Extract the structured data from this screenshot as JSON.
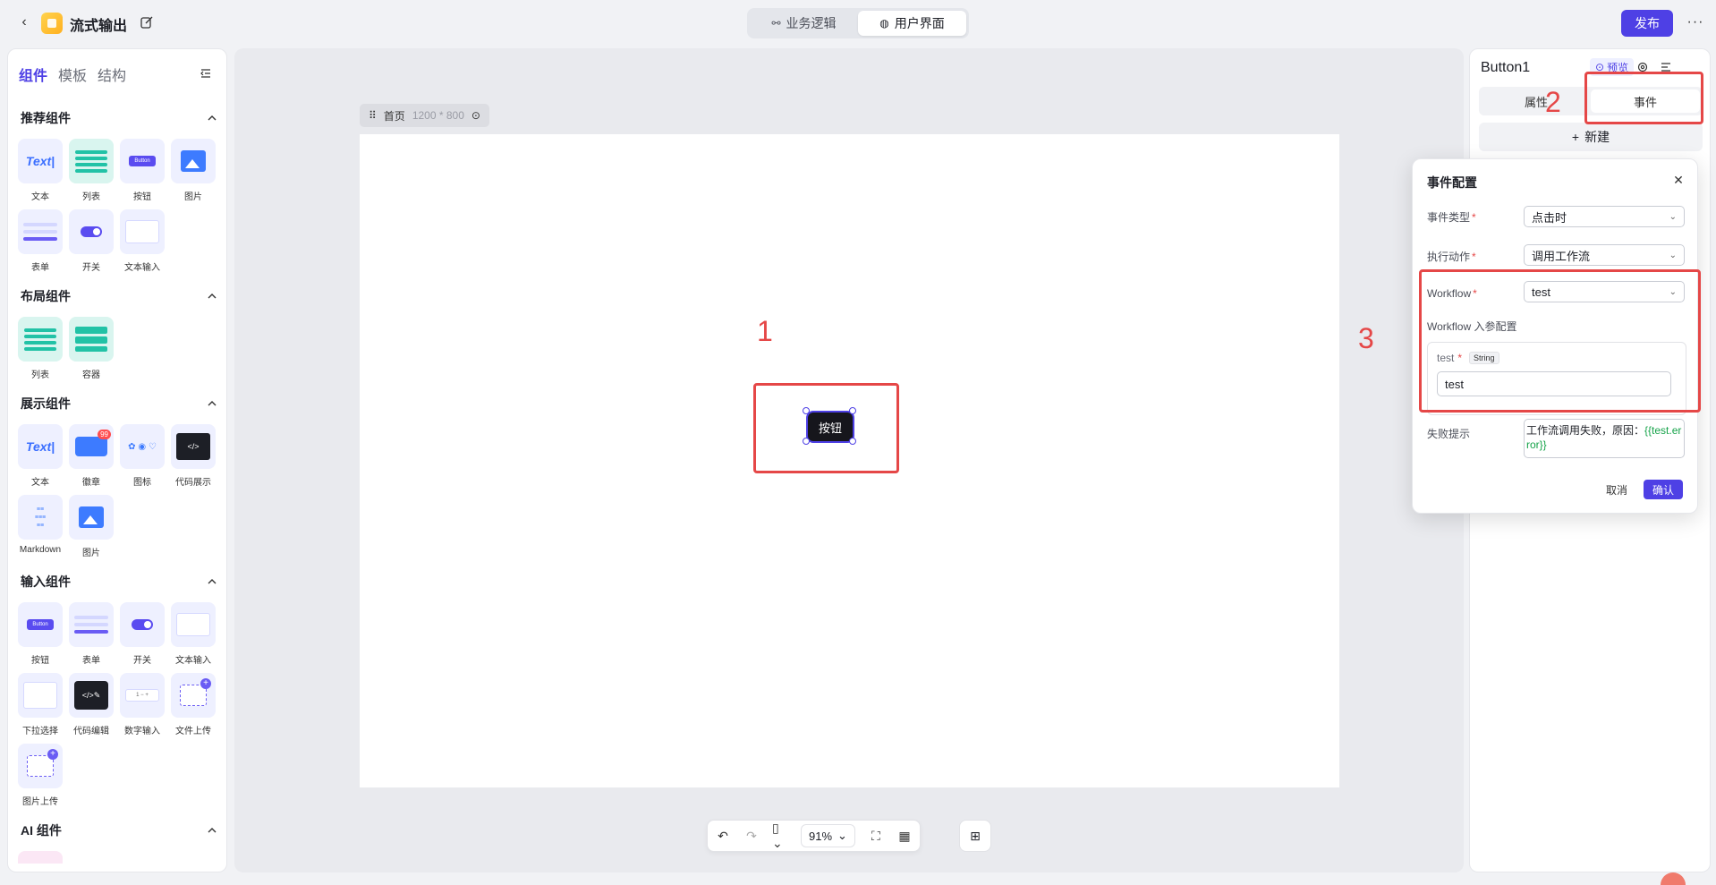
{
  "header": {
    "title": "流式输出",
    "mode_tabs": [
      "业务逻辑",
      "用户界面"
    ],
    "active_mode": "用户界面",
    "publish_label": "发布"
  },
  "left_panel": {
    "tabs": [
      "组件",
      "模板",
      "结构"
    ],
    "sections": [
      {
        "title": "推荐组件",
        "items": [
          "文本",
          "列表",
          "按钮",
          "图片",
          "表单",
          "开关",
          "文本输入"
        ]
      },
      {
        "title": "布局组件",
        "items": [
          "列表",
          "容器"
        ]
      },
      {
        "title": "展示组件",
        "items": [
          "文本",
          "徽章",
          "图标",
          "代码展示",
          "Markdown",
          "图片"
        ]
      },
      {
        "title": "输入组件",
        "items": [
          "按钮",
          "表单",
          "开关",
          "文本输入",
          "下拉选择",
          "代码编辑",
          "数字输入",
          "文件上传",
          "图片上传"
        ]
      },
      {
        "title": "AI 组件",
        "items": []
      }
    ],
    "thumb_text": {
      "text": "Text|",
      "button": "Button",
      "badge": "99",
      "markdown": "Markdown"
    }
  },
  "canvas": {
    "page_name": "首页",
    "page_size": "1200 * 800",
    "button_label": "按钮",
    "zoom": "91%"
  },
  "annotations": [
    "1",
    "2",
    "3"
  ],
  "right_panel": {
    "component_name": "Button1",
    "preview_label": "预览",
    "tabs": [
      "属性",
      "事件"
    ],
    "active_tab": "事件",
    "new_label": "新建"
  },
  "event_config": {
    "title": "事件配置",
    "event_type_label": "事件类型",
    "event_type_value": "点击时",
    "action_label": "执行动作",
    "action_value": "调用工作流",
    "workflow_label": "Workflow",
    "workflow_value": "test",
    "params_label": "Workflow 入参配置",
    "param_name": "test",
    "param_type": "String",
    "param_value": "test",
    "fail_label": "失败提示",
    "fail_text": "工作流调用失败，原因：",
    "fail_var": "{{test.error}}",
    "cancel_label": "取消",
    "confirm_label": "确认"
  },
  "colors": {
    "accent": "#4e40e5",
    "annotation": "#e54747"
  }
}
